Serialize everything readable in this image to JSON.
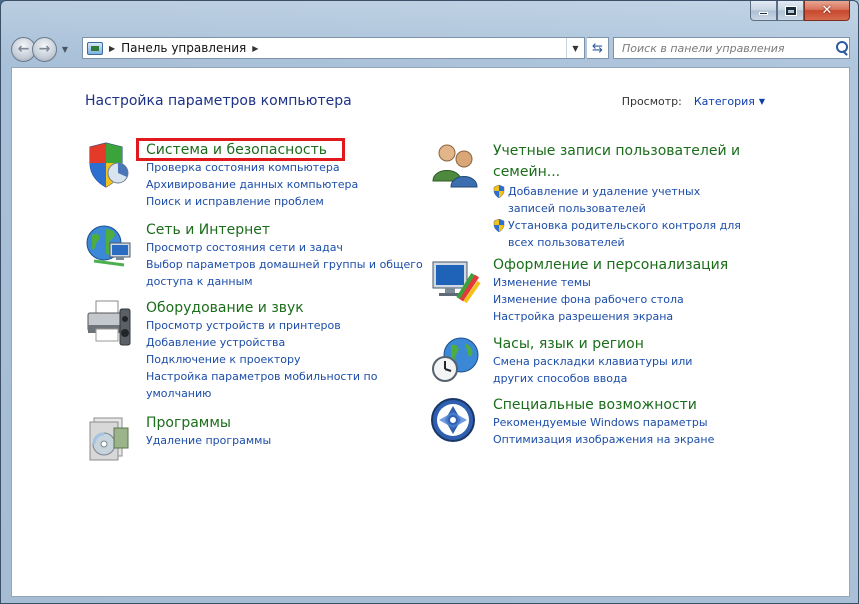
{
  "window": {
    "address_path": "Панель управления",
    "search_placeholder": "Поиск в панели управления"
  },
  "content": {
    "page_title": "Настройка параметров компьютера",
    "view_label": "Просмотр:",
    "view_value": "Категория"
  },
  "left_categories": [
    {
      "title": "Система и безопасность",
      "links": [
        "Проверка состояния компьютера",
        "Архивирование данных компьютера",
        "Поиск и исправление проблем"
      ]
    },
    {
      "title": "Сеть и Интернет",
      "links": [
        "Просмотр состояния сети и задач",
        "Выбор параметров домашней группы и общего доступа к данным"
      ]
    },
    {
      "title": "Оборудование и звук",
      "links": [
        "Просмотр устройств и принтеров",
        "Добавление устройства",
        "Подключение к проектору",
        "Настройка параметров мобильности по умолчанию"
      ]
    },
    {
      "title": "Программы",
      "links": [
        "Удаление программы"
      ]
    }
  ],
  "right_categories": [
    {
      "title": "Учетные записи пользователей и семейн...",
      "links": [
        "Добавление и удаление учетных записей пользователей",
        "Установка родительского контроля для всех пользователей"
      ]
    },
    {
      "title": "Оформление и персонализация",
      "links": [
        "Изменение темы",
        "Изменение фона рабочего стола",
        "Настройка разрешения экрана"
      ]
    },
    {
      "title": "Часы, язык и регион",
      "links": [
        "Смена раскладки клавиатуры или других способов ввода"
      ]
    },
    {
      "title": "Специальные возможности",
      "links": [
        "Рекомендуемые Windows параметры",
        "Оптимизация изображения на экране"
      ]
    }
  ],
  "colors": {
    "category_title": "#1b6d1b",
    "link": "#1c4da8",
    "page_title": "#1e3287",
    "highlight": "#e0191c"
  }
}
